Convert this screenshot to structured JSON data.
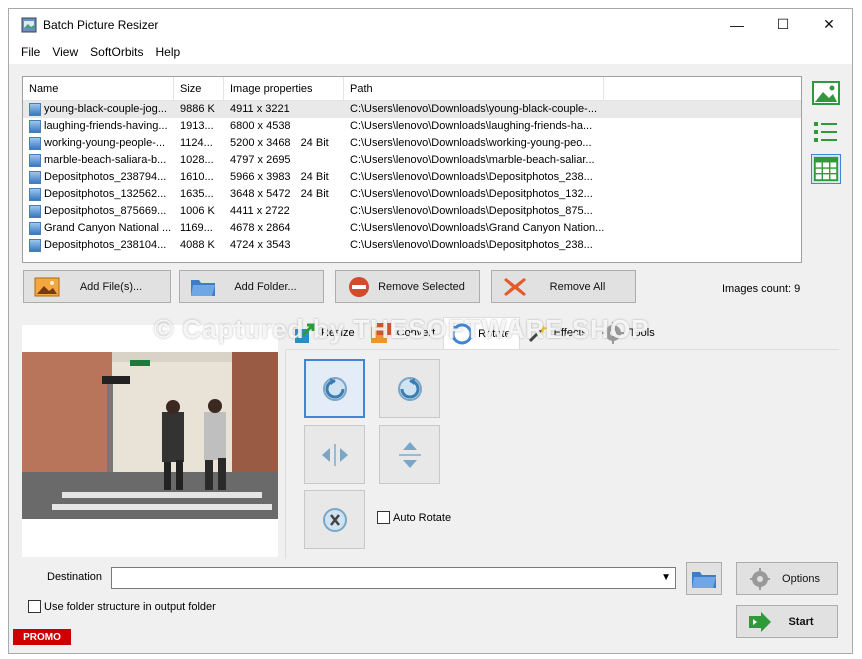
{
  "window": {
    "title": "Batch Picture Resizer",
    "controls": {
      "minimize": "—",
      "maximize": "☐",
      "close": "✕"
    }
  },
  "menu": [
    "File",
    "View",
    "SoftOrbits",
    "Help"
  ],
  "file_list": {
    "columns": [
      "Name",
      "Size",
      "Image properties",
      "Path"
    ],
    "rows": [
      {
        "name": "young-black-couple-jog...",
        "size": "9886 K",
        "props": "4911 x 3221",
        "bits": "",
        "path": "C:\\Users\\lenovo\\Downloads\\young-black-couple-..."
      },
      {
        "name": "laughing-friends-having...",
        "size": "1913...",
        "props": "6800 x 4538",
        "bits": "",
        "path": "C:\\Users\\lenovo\\Downloads\\laughing-friends-ha..."
      },
      {
        "name": "working-young-people-...",
        "size": "1124...",
        "props": "5200 x 3468",
        "bits": "24 Bit",
        "path": "C:\\Users\\lenovo\\Downloads\\working-young-peo..."
      },
      {
        "name": "marble-beach-saliara-b...",
        "size": "1028...",
        "props": "4797 x 2695",
        "bits": "",
        "path": "C:\\Users\\lenovo\\Downloads\\marble-beach-saliar..."
      },
      {
        "name": "Depositphotos_238794...",
        "size": "1610...",
        "props": "5966 x 3983",
        "bits": "24 Bit",
        "path": "C:\\Users\\lenovo\\Downloads\\Depositphotos_238..."
      },
      {
        "name": "Depositphotos_132562...",
        "size": "1635...",
        "props": "3648 x 5472",
        "bits": "24 Bit",
        "path": "C:\\Users\\lenovo\\Downloads\\Depositphotos_132..."
      },
      {
        "name": "Depositphotos_875669...",
        "size": "1006 K",
        "props": "4411 x 2722",
        "bits": "",
        "path": "C:\\Users\\lenovo\\Downloads\\Depositphotos_875..."
      },
      {
        "name": "Grand Canyon National ...",
        "size": "1169...",
        "props": "4678 x 2864",
        "bits": "",
        "path": "C:\\Users\\lenovo\\Downloads\\Grand Canyon Nation..."
      },
      {
        "name": "Depositphotos_238104...",
        "size": "4088 K",
        "props": "4724 x 3543",
        "bits": "",
        "path": "C:\\Users\\lenovo\\Downloads\\Depositphotos_238..."
      }
    ]
  },
  "side_views": [
    "thumbnail-view",
    "list-view",
    "table-view"
  ],
  "actions": {
    "add_files": "Add File(s)...",
    "add_folder": "Add Folder...",
    "remove_selected": "Remove Selected",
    "remove_all": "Remove All"
  },
  "images_count": "Images count: 9",
  "tabs": [
    "Resize",
    "Convert",
    "Rotate",
    "Effects",
    "Tools"
  ],
  "active_tab": "Rotate",
  "rotate": {
    "auto_rotate_label": "Auto Rotate",
    "auto_rotate_checked": false
  },
  "destination": {
    "label": "Destination",
    "value": ""
  },
  "use_folder_structure": "Use folder structure in output folder",
  "options_label": "Options",
  "start_label": "Start",
  "promo": "PROMO",
  "watermark": "© Captured by THESOFTWARE.SHOP",
  "colors": {
    "accent": "#3f86d6",
    "promo": "#cc0000",
    "selected_row": "#e9e9e9"
  }
}
